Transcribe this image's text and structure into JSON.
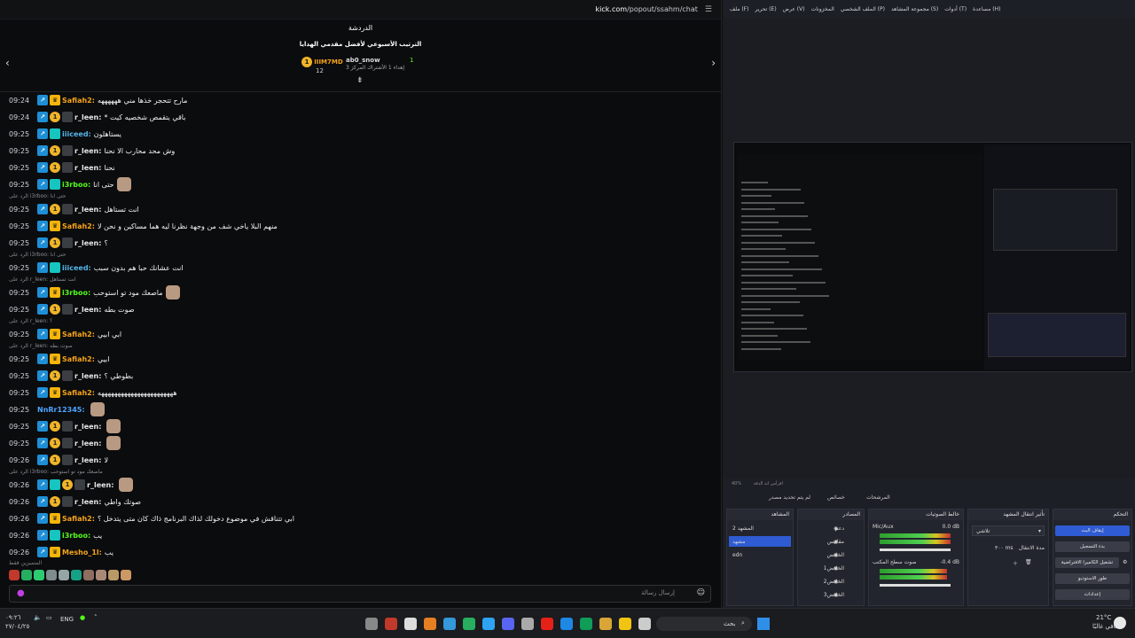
{
  "browser": {
    "url_host": "kick.com",
    "url_path": "/popout/ssahm/chat"
  },
  "chat": {
    "header": "الدردشة",
    "leaderboard_title": "الترتيب الأسبوعي لأفضل مقدمي الهدايا",
    "leaders": [
      {
        "name": "IIIM7MD",
        "count": "12"
      },
      {
        "name": "ab0_snow",
        "note": "إهداء 1 الأشتراك المركز 3"
      },
      {
        "rank": "1"
      }
    ],
    "messages": [
      {
        "time": "09:24",
        "user": "Safiah2:",
        "text": "مارح تتحجر خذها مني ﻫﻬﻬﻬﻬﻬﻪ",
        "color": "orange",
        "badges": [
          "blue",
          "crown"
        ]
      },
      {
        "time": "09:24",
        "user": "r_leen:",
        "text": "* باقي يتقمص شخصيه كيت",
        "color": "white",
        "badges": [
          "blue",
          "coin",
          "gray"
        ]
      },
      {
        "time": "09:25",
        "user": "iiiceed:",
        "text": "يستاهلون",
        "color": "cyan",
        "badges": [
          "blue",
          "cyan"
        ]
      },
      {
        "time": "09:25",
        "user": "r_leen:",
        "text": "وش محد محارب الا نحنا",
        "color": "white",
        "badges": [
          "blue",
          "coin",
          "gray"
        ]
      },
      {
        "time": "09:25",
        "user": "r_leen:",
        "text": "نحنا",
        "color": "white",
        "badges": [
          "blue",
          "coin",
          "gray"
        ]
      },
      {
        "time": "09:25",
        "user": "i3rboo:",
        "text": "حتى انا",
        "color": "green",
        "badges": [
          "blue",
          "cyan"
        ],
        "emote": true
      },
      {
        "reply": "الرد على i3rboo: حتى انا"
      },
      {
        "time": "09:25",
        "user": "r_leen:",
        "text": "انت تستاهل",
        "color": "white",
        "badges": [
          "blue",
          "coin",
          "gray"
        ]
      },
      {
        "time": "09:25",
        "user": "Safiah2:",
        "text": "منهم البلا ياخي شف من وجهة نظرنا ليه هما مساكين و نحن لا",
        "color": "orange",
        "badges": [
          "blue",
          "crown"
        ]
      },
      {
        "time": "09:25",
        "user": "r_leen:",
        "text": "؟",
        "color": "white",
        "badges": [
          "blue",
          "coin",
          "gray"
        ]
      },
      {
        "reply": "الرد على i3rboo: حتى انا"
      },
      {
        "time": "09:25",
        "user": "iiiceed:",
        "text": "انت عشانك حبا هم بدون سبب",
        "color": "cyan",
        "badges": [
          "blue",
          "cyan"
        ]
      },
      {
        "reply": "الرد على r_leen: انت تستاهل"
      },
      {
        "time": "09:25",
        "user": "i3rboo:",
        "text": "ماصعك مود تو استوحب",
        "color": "green",
        "badges": [
          "blue",
          "crown"
        ],
        "emote": true
      },
      {
        "time": "09:25",
        "user": "r_leen:",
        "text": "صوت بطه",
        "color": "white",
        "badges": [
          "blue",
          "coin",
          "gray"
        ]
      },
      {
        "reply": "الرد على r_leen: ؟"
      },
      {
        "time": "09:25",
        "user": "Safiah2:",
        "text": "ابي ابيي",
        "color": "orange",
        "badges": [
          "blue",
          "crown"
        ]
      },
      {
        "reply": "الرد على r_leen: صوت بطه"
      },
      {
        "time": "09:25",
        "user": "Safiah2:",
        "text": "ابيي",
        "color": "orange",
        "badges": [
          "blue",
          "crown"
        ]
      },
      {
        "time": "09:25",
        "user": "r_leen:",
        "text": "بطوطي ؟",
        "color": "white",
        "badges": [
          "blue",
          "coin",
          "gray"
        ]
      },
      {
        "time": "09:25",
        "user": "Safiah2:",
        "text": "ﻫﻬﻬﻬﻬﻬﻬﻬﻬﻬﻬﻬﻬﻬﻬﻬﻬﻬﻬﻬﻬﻬﻬﻪ",
        "color": "orange",
        "badges": [
          "blue",
          "crown"
        ]
      },
      {
        "time": "09:25",
        "user": "NnRr12345:",
        "text": "",
        "color": "blue2",
        "badges": [],
        "emote": true
      },
      {
        "time": "09:25",
        "user": "r_leen:",
        "text": "",
        "color": "white",
        "badges": [
          "blue",
          "coin",
          "gray"
        ],
        "emote": true
      },
      {
        "time": "09:25",
        "user": "r_leen:",
        "text": "",
        "color": "white",
        "badges": [
          "blue",
          "coin",
          "gray"
        ],
        "emote": true
      },
      {
        "time": "09:26",
        "user": "r_leen:",
        "text": "لا",
        "color": "white",
        "badges": [
          "blue",
          "coin",
          "gray"
        ]
      },
      {
        "reply": "الرد على i3rboo: ماصعك مود تو استوحب"
      },
      {
        "time": "09:26",
        "user": "r_leen:",
        "text": "",
        "color": "white",
        "badges": [
          "blue",
          "cyan",
          "coin",
          "gray"
        ],
        "emote": true
      },
      {
        "time": "09:26",
        "user": "r_leen:",
        "text": "صوتك واطي",
        "color": "white",
        "badges": [
          "blue",
          "coin",
          "gray"
        ]
      },
      {
        "time": "09:26",
        "user": "Safiah2:",
        "text": "ابي تتناقش في موضوع دخولك لذاك البرنامج ذاك كان متى يتدخل ؟",
        "color": "orange",
        "badges": [
          "blue",
          "crown"
        ]
      },
      {
        "time": "09:26",
        "user": "i3rboo:",
        "text": "يب",
        "color": "green",
        "badges": [
          "blue",
          "cyan"
        ]
      },
      {
        "time": "09:26",
        "user": "Mesho_1l:",
        "text": "يب",
        "color": "orange",
        "badges": [
          "blue",
          "crown"
        ]
      }
    ],
    "emote_label": "المتميزين فقط",
    "input_placeholder": "إرسال رسالة"
  },
  "obs": {
    "menu": [
      "ملف (F)",
      "تحرير (E)",
      "عرض (V)",
      "المخزونات",
      "الملف الشخصي (P)",
      "مجموعة المشاهد (S)",
      "أدوات (T)",
      "مساعدة (H)"
    ],
    "status": "اقرأس اند الدقة",
    "zoom": "40%",
    "tabs": [
      "المرشحات",
      "خصائص",
      "لم يتم تحديد مصدر"
    ],
    "scenes_title": "المشاهد",
    "scenes": [
      "المشهد 2",
      "مشهد",
      "edn"
    ],
    "sources_title": "المصادر",
    "sources": [
      "دعم",
      "مقاييس",
      "الخافض",
      "الخافض1",
      "الخافض2",
      "الخافض3"
    ],
    "mixer_title": "خالط الصوتيات",
    "mixer": [
      {
        "name": "Mic/Aux",
        "db": "0.0 dB"
      },
      {
        "name": "صوت سطح المكتب",
        "db": "-0.4 dB"
      }
    ],
    "transitions_title": "تأثير انتقال المشهد",
    "transition": "تلاشي",
    "duration_label": "مدة الانتقال",
    "duration": "٣٠٠ ms",
    "controls_title": "التحكم",
    "controls": [
      "إيقاف البث",
      "بدء التسجيل",
      "تشغيل الكاميرا الافتراضية",
      "طور الاستوديو",
      "إعدادات"
    ]
  },
  "taskbar": {
    "lang": "ENG",
    "time": "٠٩:٢٦",
    "date": "٢٧/٠٤/٢٥",
    "weather_temp": "21°C",
    "weather_text": "صافي غالبًا",
    "search": "بحث"
  }
}
